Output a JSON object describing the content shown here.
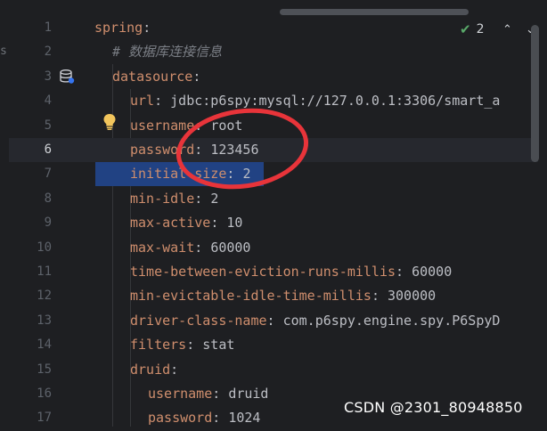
{
  "editor": {
    "lines": [
      {
        "num": "1",
        "key": "spring",
        "sep": ":",
        "value": ""
      },
      {
        "num": "2",
        "comment": "# 数据库连接信息"
      },
      {
        "num": "3",
        "key": "datasource",
        "sep": ":",
        "value": ""
      },
      {
        "num": "4",
        "key": "url",
        "sep": ": ",
        "value": "jdbc:p6spy:mysql://127.0.0.1:3306/smart_a"
      },
      {
        "num": "5",
        "key": "username",
        "sep": ": ",
        "value": "root"
      },
      {
        "num": "6",
        "key": "password",
        "sep": ": ",
        "value": "123456"
      },
      {
        "num": "7",
        "key": "initial-size",
        "sep": ": ",
        "value": "2"
      },
      {
        "num": "8",
        "key": "min-idle",
        "sep": ": ",
        "value": "2"
      },
      {
        "num": "9",
        "key": "max-active",
        "sep": ": ",
        "value": "10"
      },
      {
        "num": "10",
        "key": "max-wait",
        "sep": ": ",
        "value": "60000"
      },
      {
        "num": "11",
        "key": "time-between-eviction-runs-millis",
        "sep": ": ",
        "value": "60000"
      },
      {
        "num": "12",
        "key": "min-evictable-idle-time-millis",
        "sep": ": ",
        "value": "300000"
      },
      {
        "num": "13",
        "key": "driver-class-name",
        "sep": ": ",
        "value": "com.p6spy.engine.spy.P6SpyD"
      },
      {
        "num": "14",
        "key": "filters",
        "sep": ": ",
        "value": "stat"
      },
      {
        "num": "15",
        "key": "druid",
        "sep": ":",
        "value": ""
      },
      {
        "num": "16",
        "key": "username",
        "sep": ": ",
        "value": "druid"
      },
      {
        "num": "17",
        "key": "password",
        "sep": ": ",
        "value": "1024"
      }
    ],
    "current_line": "6"
  },
  "inspections": {
    "count": "2"
  },
  "icons": {
    "check": "check-icon",
    "prev": "chevron-up-icon",
    "next": "chevron-down-icon",
    "datasource": "database-icon",
    "hint": "lightbulb-icon"
  },
  "colors": {
    "background": "#1e1f22",
    "key": "#cf8e6d",
    "value": "#bcbec4",
    "comment": "#7a7e85",
    "selection": "#214283",
    "annotation": "#e8343a"
  },
  "watermark": "CSDN @2301_80948850"
}
